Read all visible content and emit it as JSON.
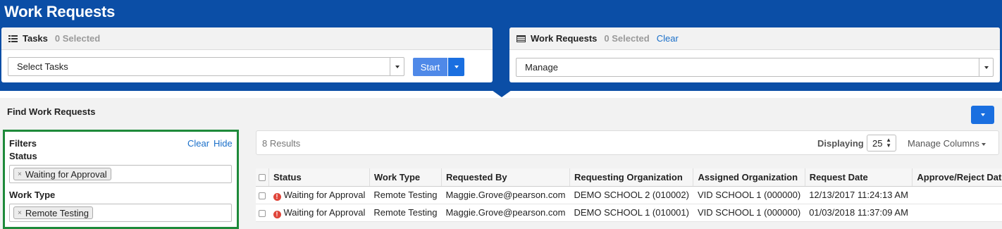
{
  "page": {
    "title": "Work Requests"
  },
  "tasks_panel": {
    "title": "Tasks",
    "selected": "0 Selected",
    "select_placeholder": "Select Tasks",
    "start_label": "Start"
  },
  "requests_panel": {
    "title": "Work Requests",
    "selected": "0 Selected",
    "clear_label": "Clear",
    "select_value": "Manage"
  },
  "find": {
    "title": "Find Work Requests"
  },
  "filters": {
    "title": "Filters",
    "clear_label": "Clear",
    "hide_label": "Hide",
    "status_label": "Status",
    "status_chip": "Waiting for Approval",
    "work_type_label": "Work Type",
    "work_type_chip": "Remote Testing",
    "chip_remove": "×"
  },
  "results": {
    "count": "8 Results",
    "displaying_label": "Displaying",
    "page_size": "25",
    "manage_columns": "Manage Columns"
  },
  "table": {
    "headers": [
      "Status",
      "Work Type",
      "Requested By",
      "Requesting Organization",
      "Assigned Organization",
      "Request Date",
      "Approve/Reject Date"
    ],
    "rows": [
      [
        "Waiting for Approval",
        "Remote Testing",
        "Maggie.Grove@pearson.com",
        "DEMO SCHOOL 2 (010002)",
        "VID SCHOOL 1 (000000)",
        "12/13/2017 11:24:13 AM",
        ""
      ],
      [
        "Waiting for Approval",
        "Remote Testing",
        "Maggie.Grove@pearson.com",
        "DEMO SCHOOL 1 (010001)",
        "VID SCHOOL 1 (000000)",
        "01/03/2018 11:37:09 AM",
        ""
      ]
    ]
  },
  "colors": {
    "header_band": "#0b4ea6",
    "primary_button": "#1a6fe0",
    "link": "#1a6fc9",
    "filter_highlight": "#1e8a3a",
    "warning": "#e0453a"
  },
  "icons": {
    "tasks_icon": "list-icon",
    "requests_icon": "table-icon",
    "status_icon": "exclamation-circle-icon"
  }
}
